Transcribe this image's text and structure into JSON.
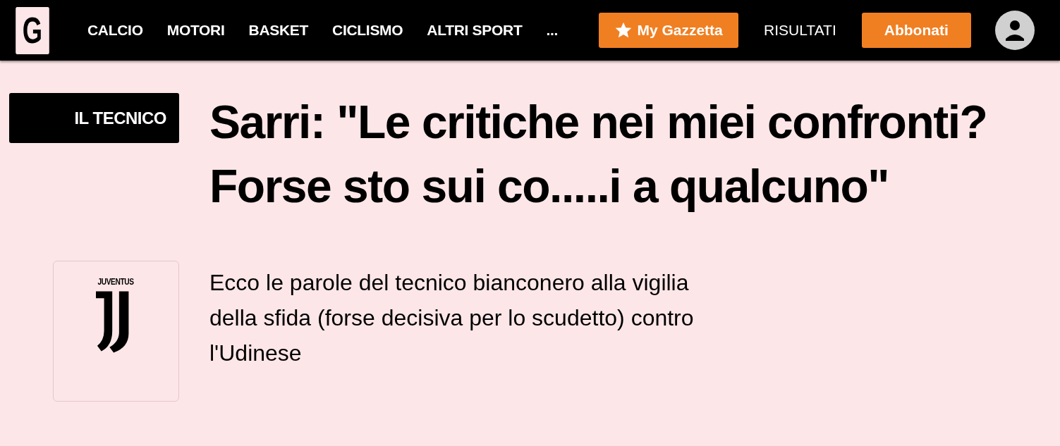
{
  "header": {
    "logo": "G",
    "nav": [
      {
        "label": "CALCIO"
      },
      {
        "label": "MOTORI"
      },
      {
        "label": "BASKET"
      },
      {
        "label": "CICLISMO"
      },
      {
        "label": "ALTRI SPORT"
      },
      {
        "label": "..."
      }
    ],
    "my_gazzetta": "My Gazzetta",
    "results_link": "RISULTATI",
    "subscribe_button": "Abbonati"
  },
  "article": {
    "kicker": "IL TECNICO",
    "headline": "Sarri: \"Le critiche nei miei confronti? Forse sto sui co.....i a qualcuno\"",
    "team_logo": {
      "wordmark": "JUVENTUS"
    },
    "summary": "Ecco le parole del tecnico bianconero alla vigilia della sfida (forse decisiva per lo scudetto) contro l'Udinese"
  }
}
